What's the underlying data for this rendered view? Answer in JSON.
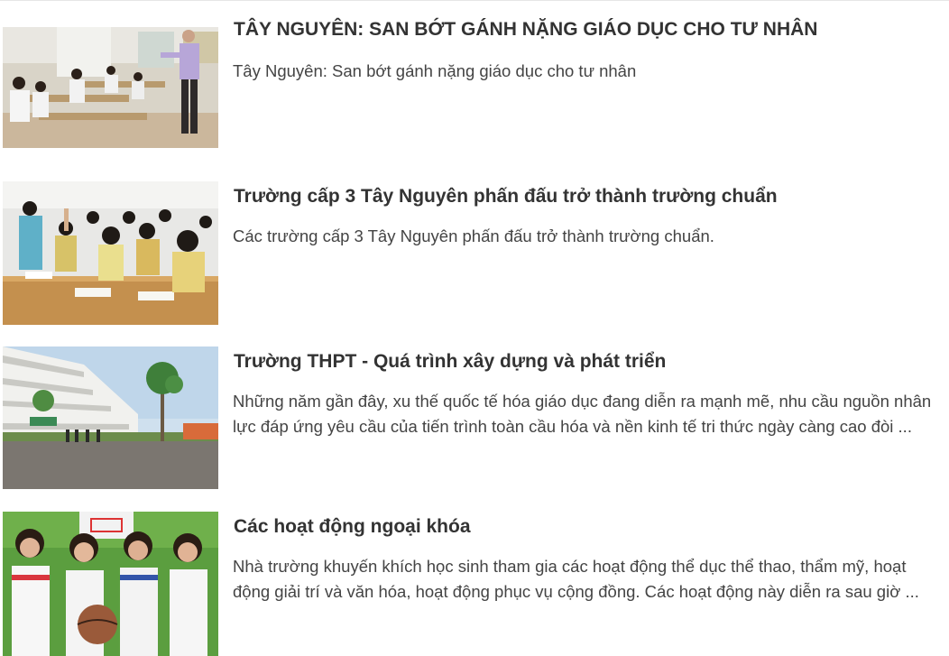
{
  "articles": [
    {
      "title": "TÂY NGUYÊN: SAN BỚT GÁNH NẶNG GIÁO DỤC CHO TƯ NHÂN",
      "summary": "Tây Nguyên: San bớt gánh nặng giáo dục cho tư nhân",
      "image": "classroom-teacher-photo"
    },
    {
      "title": "Trường cấp 3 Tây Nguyên phấn đấu trở thành trường chuẩn",
      "summary": "Các trường cấp 3 Tây Nguyên phấn đấu trở thành trường chuẩn.",
      "image": "students-raising-hands-photo"
    },
    {
      "title": "Trường THPT - Quá trình xây dựng và phát triển",
      "summary": "Những năm gần đây, xu thế quốc tế hóa giáo dục đang diễn ra mạnh mẽ, nhu cầu nguồn nhân lực đáp ứng yêu cầu của tiến trình toàn cầu hóa và nền kinh tế tri thức ngày càng cao đòi ...",
      "image": "school-building-photo"
    },
    {
      "title": "Các hoạt động ngoại khóa",
      "summary": "Nhà trường khuyến khích học sinh tham gia các hoạt động thể dục thể thao, thẩm mỹ, hoạt động giải trí và văn hóa, hoạt động phục vụ cộng đồng. Các hoạt động này diễn ra sau giờ ...",
      "image": "basketball-girls-photo"
    }
  ]
}
